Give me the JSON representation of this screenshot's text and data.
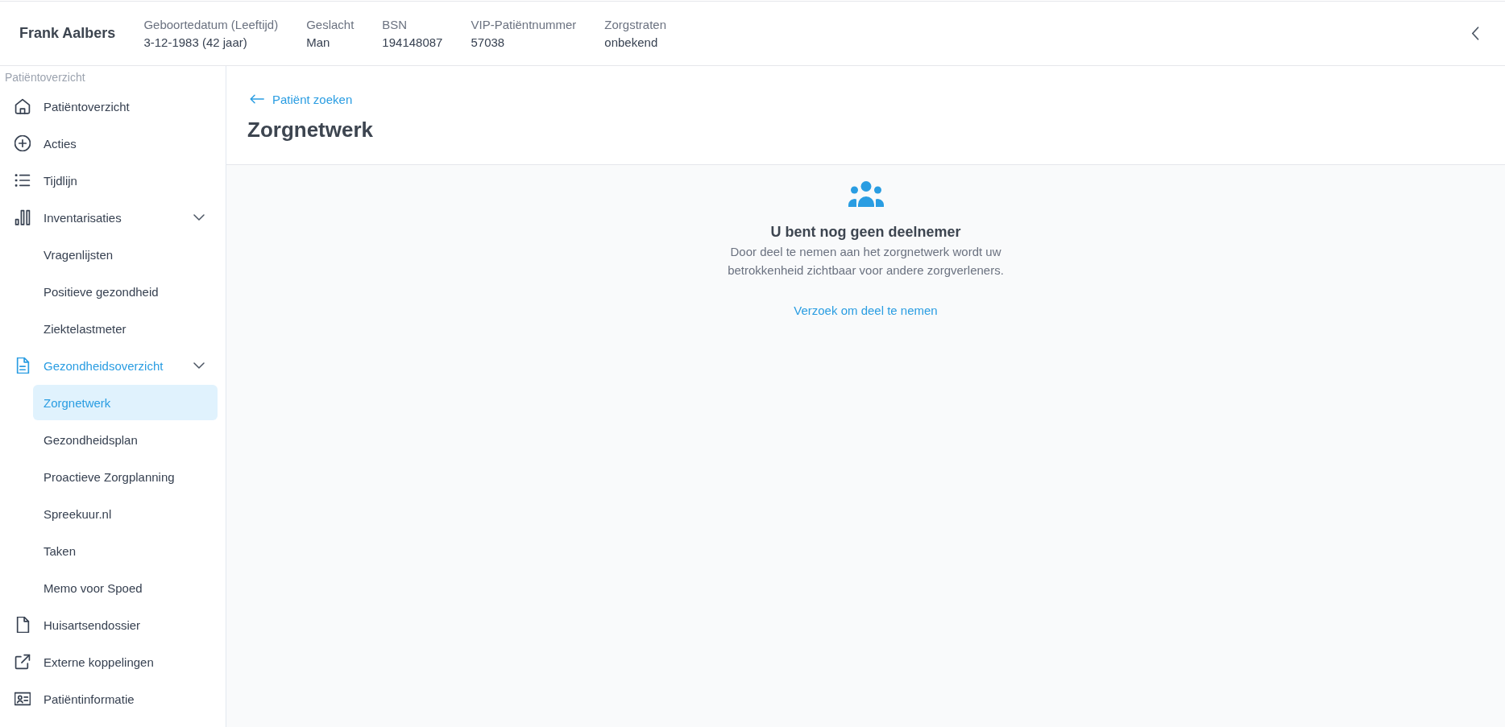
{
  "header": {
    "patient_name": "Frank Aalbers",
    "fields": [
      {
        "label": "Geboortedatum (Leeftijd)",
        "value": "3-12-1983 (42 jaar)"
      },
      {
        "label": "Geslacht",
        "value": "Man"
      },
      {
        "label": "BSN",
        "value": "194148087"
      },
      {
        "label": "VIP-Patiëntnummer",
        "value": "57038"
      },
      {
        "label": "Zorgstraten",
        "value": "onbekend"
      }
    ]
  },
  "sidebar": {
    "section_label": "Patiëntoverzicht",
    "items": [
      {
        "label": "Patiëntoverzicht",
        "selected": false
      },
      {
        "label": "Acties",
        "selected": false
      },
      {
        "label": "Tijdlijn",
        "selected": false
      },
      {
        "label": "Inventarisaties",
        "selected": false,
        "expanded": true,
        "children": [
          {
            "label": "Vragenlijsten",
            "selected": false
          },
          {
            "label": "Positieve gezondheid",
            "selected": false
          },
          {
            "label": "Ziektelastmeter",
            "selected": false
          }
        ]
      },
      {
        "label": "Gezondheidsoverzicht",
        "selected": false,
        "expanded": true,
        "children": [
          {
            "label": "Zorgnetwerk",
            "selected": true
          },
          {
            "label": "Gezondheidsplan",
            "selected": false
          },
          {
            "label": "Proactieve Zorgplanning",
            "selected": false
          },
          {
            "label": "Spreekuur.nl",
            "selected": false
          },
          {
            "label": "Taken",
            "selected": false
          },
          {
            "label": "Memo voor Spoed",
            "selected": false
          }
        ]
      },
      {
        "label": "Huisartsendossier",
        "selected": false
      },
      {
        "label": "Externe koppelingen",
        "selected": false
      },
      {
        "label": "Patiëntinformatie",
        "selected": false
      }
    ]
  },
  "main": {
    "back_link": "Patiënt zoeken",
    "title": "Zorgnetwerk",
    "empty_state": {
      "title": "U bent nog geen deelnemer",
      "description": "Door deel te nemen aan het zorgnetwerk wordt uw betrokkenheid zichtbaar voor andere zorgverleners.",
      "action_link": "Verzoek om deel te nemen"
    }
  }
}
